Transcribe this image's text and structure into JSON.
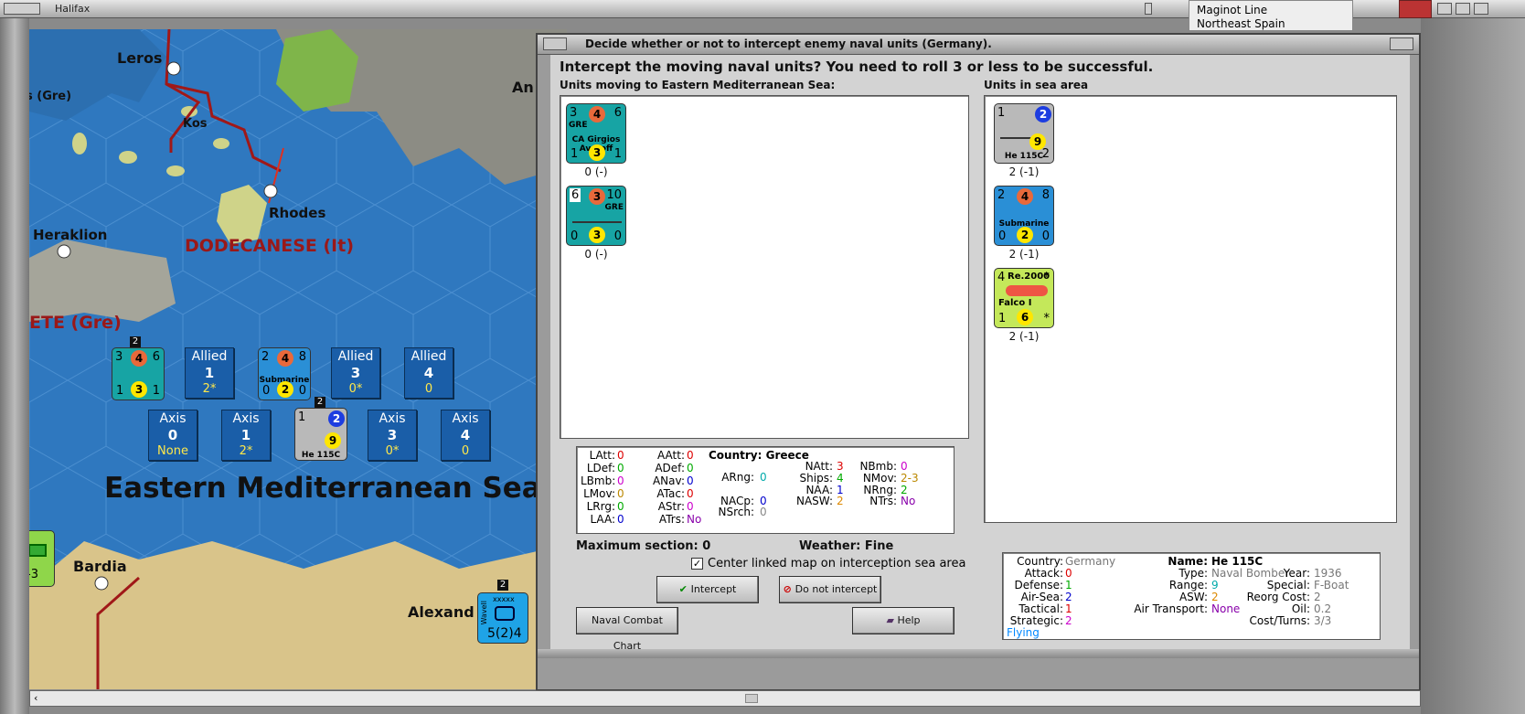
{
  "window": {
    "title": "Halifax"
  },
  "top_list": {
    "items": [
      "Maginot Line",
      "Northeast Spain"
    ]
  },
  "map": {
    "labels": {
      "leros": "Leros",
      "gre_left": "s (Gre)",
      "kos": "Kos",
      "rhodes": "Rhodes",
      "heraklion": "Heraklion",
      "dodecanese": "DODECANESE (It)",
      "crete": "ETE (Gre)",
      "sea": "Eastern Mediterranean Sea",
      "bardia": "Bardia",
      "alexandria": "Alexand",
      "an": "An"
    },
    "allied_boxes": [
      {
        "side": "Allied",
        "num": "1",
        "val": "2*"
      },
      {
        "side": "Allied",
        "num": "3",
        "val": "0*"
      },
      {
        "side": "Allied",
        "num": "4",
        "val": "0"
      }
    ],
    "axis_boxes": [
      {
        "side": "Axis",
        "num": "0",
        "val": "None"
      },
      {
        "side": "Axis",
        "num": "1",
        "val": "2*"
      },
      {
        "side": "Axis",
        "num": "3",
        "val": "0*"
      },
      {
        "side": "Axis",
        "num": "4",
        "val": "0"
      }
    ],
    "stack_badge": "2",
    "he_stack_badge": "2",
    "wavell": {
      "name": "Wavell",
      "value": "5(2)4",
      "badge": "2",
      "stars": "xxxxx"
    },
    "left_counter": {
      "val": "-3"
    }
  },
  "dialog": {
    "title": "Decide whether or not to intercept enemy naval units (Germany).",
    "question": "Intercept the moving naval units?  You need to roll 3 or less to be successful.",
    "moving_header": "Units moving to Eastern Mediterranean Sea:",
    "area_header": "Units in sea area",
    "moving_units": [
      {
        "tl": "3",
        "mid": "4",
        "tr": "6",
        "bl": "1",
        "bot": "3",
        "br": "1",
        "country": "GRE",
        "name": "CA Girgios Averoff",
        "caption": "0 (-)"
      },
      {
        "tl": "6",
        "mid": "3",
        "tr": "10",
        "bl": "0",
        "bot": "3",
        "br": "0",
        "country": "GRE",
        "name": "",
        "caption": "0 (-)"
      }
    ],
    "area_units": [
      {
        "tl": "1",
        "mid": "2",
        "bot": "9",
        "br": "2",
        "name": "He 115C",
        "caption": "2 (-1)"
      },
      {
        "tl": "2",
        "mid": "4",
        "tr": "8",
        "bl": "0",
        "bot": "2",
        "br": "0",
        "name": "Submarine",
        "caption": "2 (-1)"
      },
      {
        "tl": "4",
        "tr": "*",
        "bl": "1",
        "bot": "6",
        "br": "*",
        "name": "Re.2000",
        "sub": "Falco I",
        "caption": "2 (-1)"
      }
    ],
    "stats": {
      "latt": "0",
      "ldef": "0",
      "lbmb": "0",
      "lmov": "0",
      "lrrg": "0",
      "laa": "0",
      "aatt": "0",
      "adef": "0",
      "anav": "0",
      "atac": "0",
      "astr": "0",
      "atrs": "No",
      "country_label": "Country: Greece",
      "arng": "0",
      "nacp": "0",
      "nsrch": "0",
      "natt": "3",
      "ships": "4",
      "naa": "1",
      "nasw": "2",
      "nbmb": "0",
      "nmov": "2-3",
      "nrng": "2",
      "ntrs": "No"
    },
    "stat_labels": {
      "latt": "LAtt:",
      "ldef": "LDef:",
      "lbmb": "LBmb:",
      "lmov": "LMov:",
      "lrrg": "LRrg:",
      "laa": "LAA:",
      "aatt": "AAtt:",
      "adef": "ADef:",
      "anav": "ANav:",
      "atac": "ATac:",
      "astr": "AStr:",
      "atrs": "ATrs:",
      "arng": "ARng:",
      "nacp": "NACp:",
      "nsrch": "NSrch:",
      "natt": "NAtt:",
      "ships": "Ships:",
      "naa": "NAA:",
      "nasw": "NASW:",
      "nbmb": "NBmb:",
      "nmov": "NMov:",
      "nrng": "NRng:",
      "ntrs": "NTrs:"
    },
    "max_section": "Maximum section: 0",
    "weather": "Weather:  Fine",
    "center_checkbox": "Center linked map on interception sea area",
    "buttons": {
      "intercept": "Intercept",
      "no": "Do not intercept",
      "chart": "Naval Combat Chart",
      "help": "Help"
    },
    "unit_info": {
      "country_l": "Country:",
      "country_v": "Germany",
      "attack_l": "Attack:",
      "attack_v": "0",
      "defense_l": "Defense:",
      "defense_v": "1",
      "airsea_l": "Air-Sea:",
      "airsea_v": "2",
      "tactical_l": "Tactical:",
      "tactical_v": "1",
      "strategic_l": "Strategic:",
      "strategic_v": "2",
      "flying": "Flying",
      "name_l": "Name:",
      "name_v": "He 115C",
      "type_l": "Type:",
      "type_v": "Naval Bomber",
      "range_l": "Range:",
      "range_v": "9",
      "asw_l": "ASW:",
      "asw_v": "2",
      "airtr_l": "Air Transport:",
      "airtr_v": "None",
      "year_l": "Year:",
      "year_v": "1936",
      "special_l": "Special:",
      "special_v": "F-Boat",
      "reorg_l": "Reorg Cost:",
      "reorg_v": "2",
      "oil_l": "Oil:",
      "oil_v": "0.2",
      "cost_l": "Cost/Turns:",
      "cost_v": "3/3"
    }
  }
}
